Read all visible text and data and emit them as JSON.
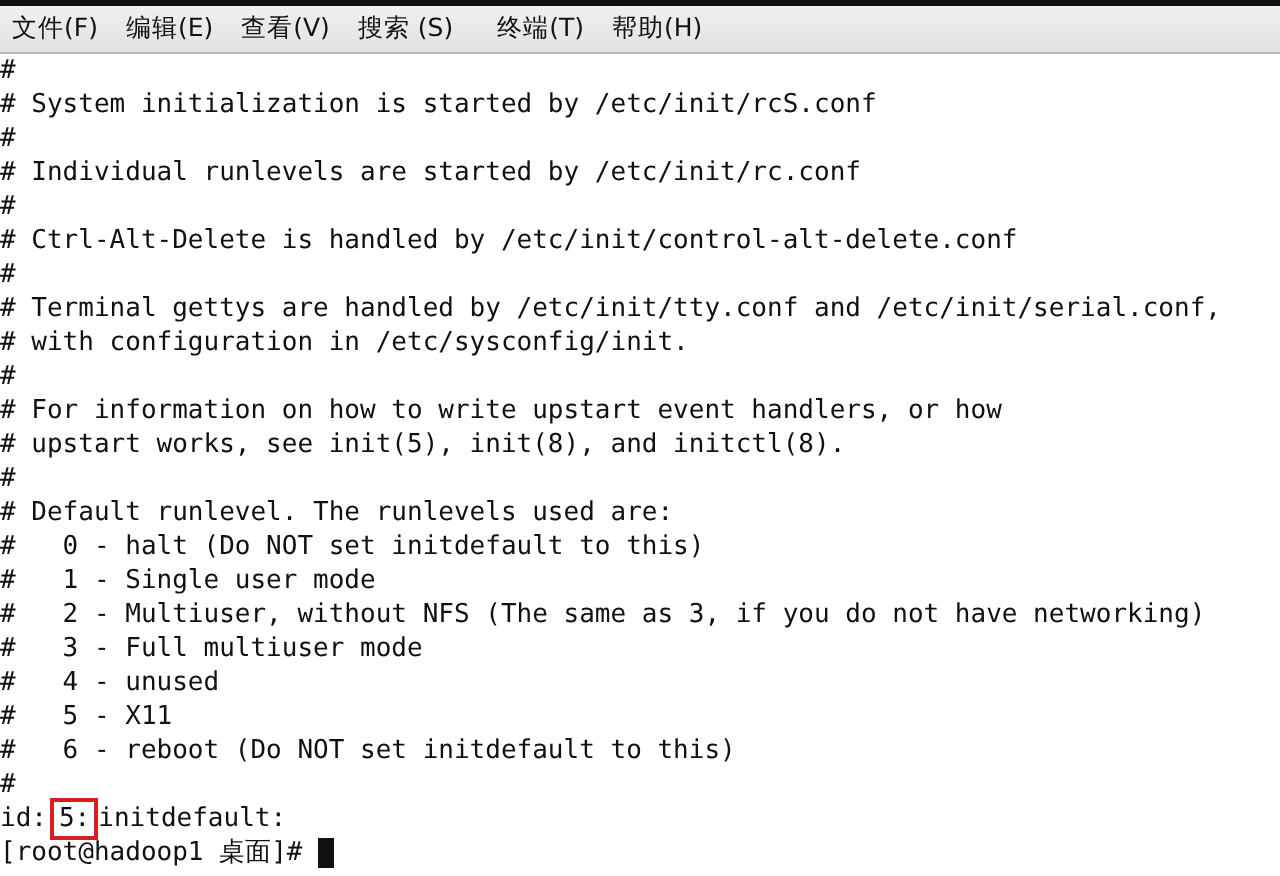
{
  "menu_bar": [
    {
      "label": "文件(F)"
    },
    {
      "label": "编辑(E)"
    },
    {
      "label": "查看(V)"
    },
    {
      "label": "搜索 (S)"
    },
    {
      "label": "终端(T)"
    },
    {
      "label": "帮助(H)"
    }
  ],
  "terminal": {
    "lines": [
      {
        "text": "#"
      },
      {
        "text": "# System initialization is started by /etc/init/rcS.conf"
      },
      {
        "text": "#"
      },
      {
        "text": "# Individual runlevels are started by /etc/init/rc.conf"
      },
      {
        "text": "#"
      },
      {
        "text": "# Ctrl-Alt-Delete is handled by /etc/init/control-alt-delete.conf"
      },
      {
        "text": "#"
      },
      {
        "text": "# Terminal gettys are handled by /etc/init/tty.conf and /etc/init/serial.conf,"
      },
      {
        "text": "# with configuration in /etc/sysconfig/init."
      },
      {
        "text": "#"
      },
      {
        "text": "# For information on how to write upstart event handlers, or how"
      },
      {
        "text": "# upstart works, see init(5), init(8), and initctl(8)."
      },
      {
        "text": "#"
      },
      {
        "text": "# Default runlevel. The runlevels used are:"
      },
      {
        "text": "#   0 - halt (Do NOT set initdefault to this)"
      },
      {
        "text": "#   1 - Single user mode"
      },
      {
        "text": "#   2 - Multiuser, without NFS (The same as 3, if you do not have networking)"
      },
      {
        "text": "#   3 - Full multiuser mode"
      },
      {
        "text": "#   4 - unused"
      },
      {
        "text": "#   5 - X11"
      },
      {
        "text": "#   6 - reboot (Do NOT set initdefault to this)"
      },
      {
        "text": "#"
      },
      {
        "segments": [
          {
            "text": "id:",
            "boxed": false
          },
          {
            "text": "5:",
            "boxed": true
          },
          {
            "text": "initdefault:",
            "boxed": false
          }
        ]
      }
    ],
    "prompt": "[root@hadoop1 桌面]# ",
    "cursor": true
  }
}
